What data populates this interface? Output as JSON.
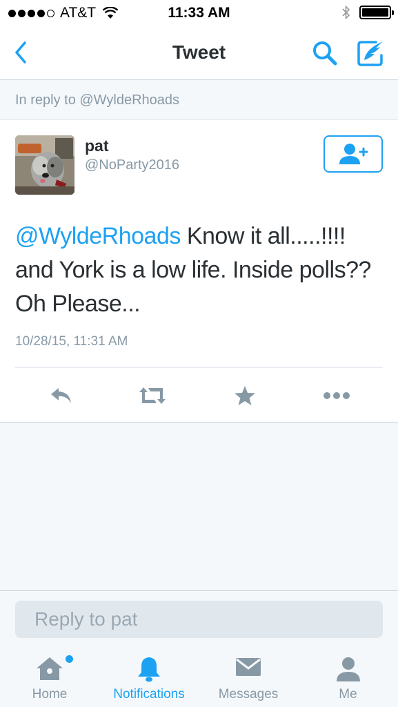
{
  "status_bar": {
    "carrier": "AT&T",
    "time": "11:33 AM"
  },
  "nav": {
    "title": "Tweet"
  },
  "reply_context": "In reply to @WyldeRhoads",
  "tweet": {
    "user_name": "pat",
    "user_handle": "@NoParty2016",
    "mention": "@WyldeRhoads",
    "text_line1": " Know it all.....!!!!",
    "text_line2": "and York is a low life. Inside polls??",
    "text_line3": "Oh Please...",
    "timestamp": "10/28/15, 11:31 AM"
  },
  "reply": {
    "placeholder": "Reply to pat"
  },
  "tabs": [
    {
      "label": "Home",
      "icon": "home-icon"
    },
    {
      "label": "Notifications",
      "icon": "bell-icon"
    },
    {
      "label": "Messages",
      "icon": "envelope-icon"
    },
    {
      "label": "Me",
      "icon": "person-icon"
    }
  ],
  "colors": {
    "accent": "#1da1f2",
    "muted": "#8899a6",
    "text": "#292f33",
    "background": "#f5f8fa"
  }
}
